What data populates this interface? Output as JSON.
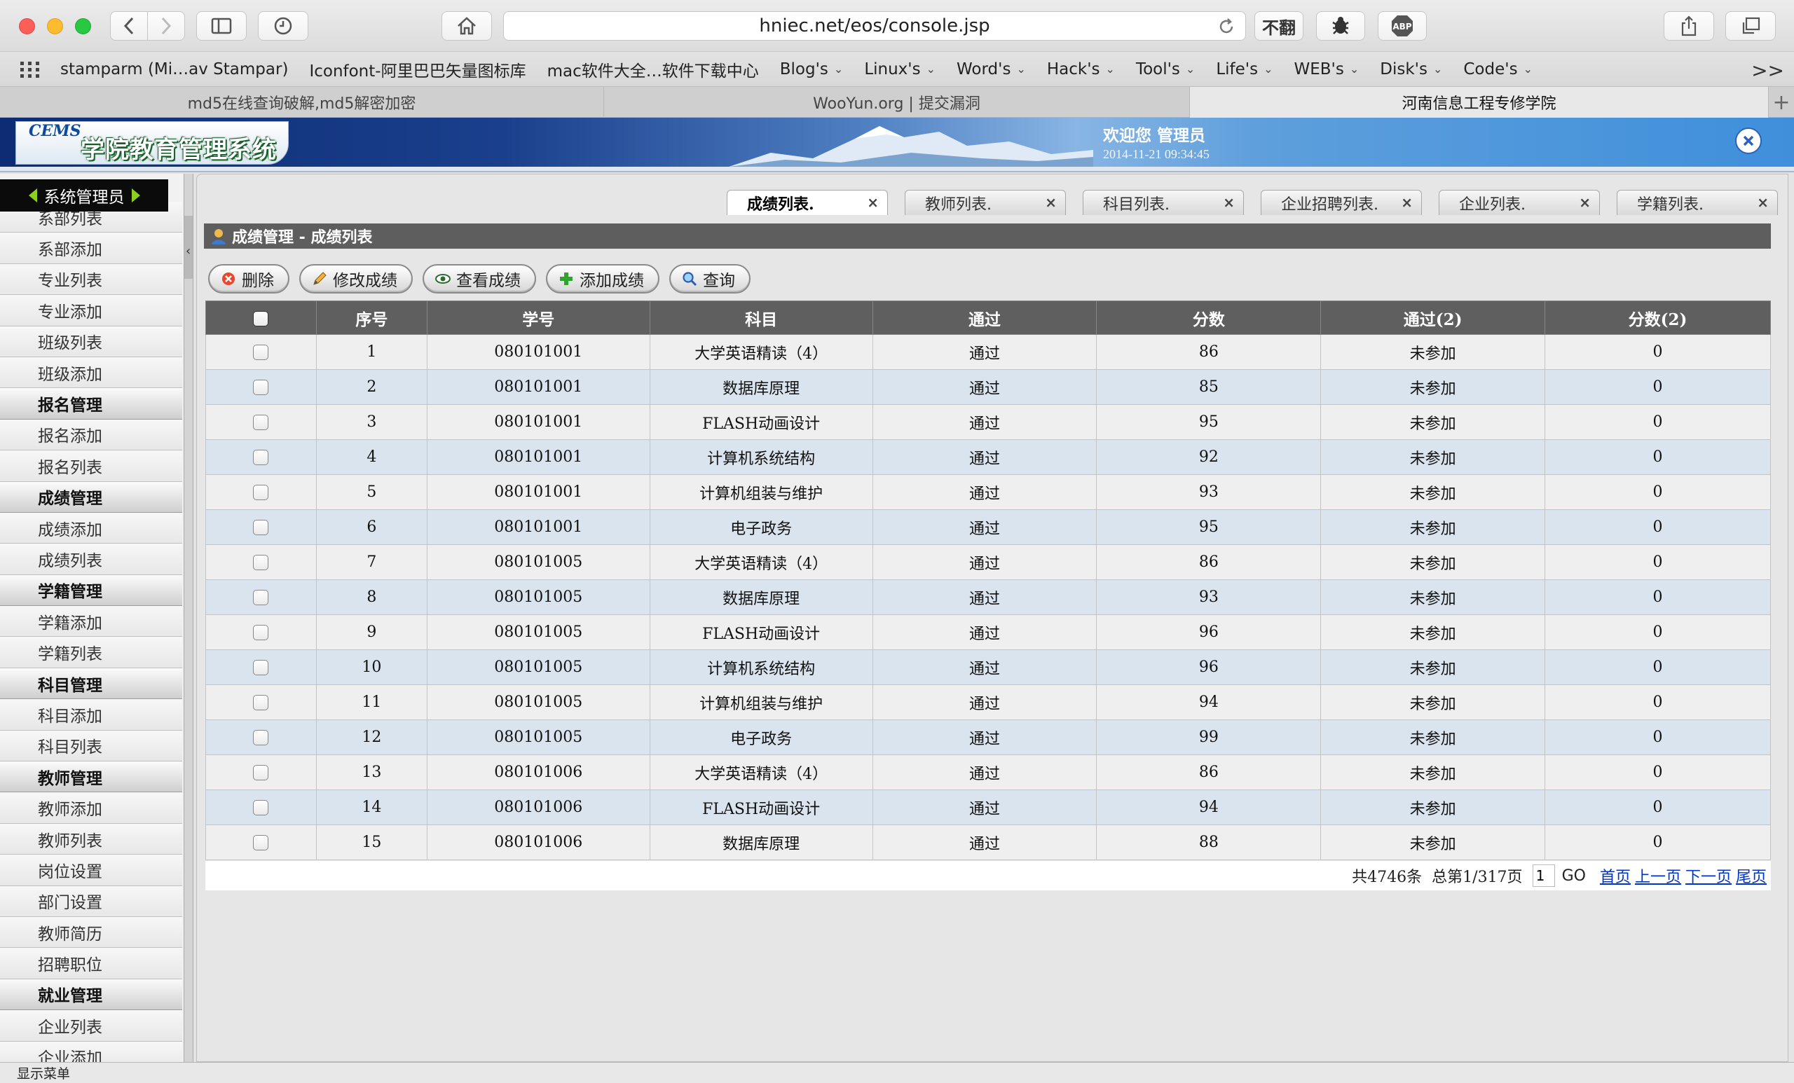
{
  "browser": {
    "url": "hniec.net/eos/console.jsp",
    "ext1": "不翻",
    "bookmarks": [
      {
        "label": "stamparm (Mi…av Stampar)",
        "menu": false
      },
      {
        "label": "Iconfont-阿里巴巴矢量图标库",
        "menu": false
      },
      {
        "label": "mac软件大全…软件下载中心",
        "menu": false
      },
      {
        "label": "Blog's",
        "menu": true
      },
      {
        "label": "Linux's",
        "menu": true
      },
      {
        "label": "Word's",
        "menu": true
      },
      {
        "label": "Hack's",
        "menu": true
      },
      {
        "label": "Tool's",
        "menu": true
      },
      {
        "label": "Life's",
        "menu": true
      },
      {
        "label": "WEB's",
        "menu": true
      },
      {
        "label": "Disk's",
        "menu": true
      },
      {
        "label": "Code's",
        "menu": true
      }
    ],
    "bookmarks_more": ">>",
    "tabs": [
      {
        "label": "md5在线查询破解,md5解密加密",
        "active": false
      },
      {
        "label": "WooYun.org | 提交漏洞",
        "active": false
      },
      {
        "label": "河南信息工程专修学院",
        "active": true
      }
    ],
    "add_tab": "+"
  },
  "header": {
    "logo_small": "CEMS",
    "logo_title": "学院教育管理系统",
    "welcome": "欢迎您 管理员",
    "datetime": "2014-11-21 09:34:45"
  },
  "sidebar": {
    "admin_label": "系统管理员",
    "items": [
      {
        "label": "系部列表",
        "type": "item"
      },
      {
        "label": "系部添加",
        "type": "item"
      },
      {
        "label": "专业列表",
        "type": "item"
      },
      {
        "label": "专业添加",
        "type": "item"
      },
      {
        "label": "班级列表",
        "type": "item"
      },
      {
        "label": "班级添加",
        "type": "item"
      },
      {
        "label": "报名管理",
        "type": "header"
      },
      {
        "label": "报名添加",
        "type": "item"
      },
      {
        "label": "报名列表",
        "type": "item"
      },
      {
        "label": "成绩管理",
        "type": "header"
      },
      {
        "label": "成绩添加",
        "type": "item"
      },
      {
        "label": "成绩列表",
        "type": "item"
      },
      {
        "label": "学籍管理",
        "type": "header"
      },
      {
        "label": "学籍添加",
        "type": "item"
      },
      {
        "label": "学籍列表",
        "type": "item"
      },
      {
        "label": "科目管理",
        "type": "header"
      },
      {
        "label": "科目添加",
        "type": "item"
      },
      {
        "label": "科目列表",
        "type": "item"
      },
      {
        "label": "教师管理",
        "type": "header"
      },
      {
        "label": "教师添加",
        "type": "item"
      },
      {
        "label": "教师列表",
        "type": "item"
      },
      {
        "label": "岗位设置",
        "type": "item"
      },
      {
        "label": "部门设置",
        "type": "item"
      },
      {
        "label": "教师简历",
        "type": "item"
      },
      {
        "label": "招聘职位",
        "type": "item"
      },
      {
        "label": "就业管理",
        "type": "header"
      },
      {
        "label": "企业列表",
        "type": "item"
      },
      {
        "label": "企业添加",
        "type": "item"
      }
    ]
  },
  "main": {
    "tabs": [
      {
        "label": "成绩列表.",
        "active": true
      },
      {
        "label": "教师列表.",
        "active": false
      },
      {
        "label": "科目列表.",
        "active": false
      },
      {
        "label": "企业招聘列表.",
        "active": false
      },
      {
        "label": "企业列表.",
        "active": false
      },
      {
        "label": "学籍列表.",
        "active": false
      }
    ],
    "tab_close": "×",
    "panel_title": "成绩管理 - 成绩列表",
    "actions": [
      {
        "label": "删除",
        "icon": "delete-icon"
      },
      {
        "label": "修改成绩",
        "icon": "edit-icon"
      },
      {
        "label": "查看成绩",
        "icon": "view-icon"
      },
      {
        "label": "添加成绩",
        "icon": "add-icon"
      },
      {
        "label": "查询",
        "icon": "search-icon"
      }
    ],
    "columns": [
      "序号",
      "学号",
      "科目",
      "通过",
      "分数",
      "通过(2)",
      "分数(2)"
    ],
    "rows": [
      [
        "1",
        "080101001",
        "大学英语精读（4）",
        "通过",
        "86",
        "未参加",
        "0"
      ],
      [
        "2",
        "080101001",
        "数据库原理",
        "通过",
        "85",
        "未参加",
        "0"
      ],
      [
        "3",
        "080101001",
        "FLASH动画设计",
        "通过",
        "95",
        "未参加",
        "0"
      ],
      [
        "4",
        "080101001",
        "计算机系统结构",
        "通过",
        "92",
        "未参加",
        "0"
      ],
      [
        "5",
        "080101001",
        "计算机组装与维护",
        "通过",
        "93",
        "未参加",
        "0"
      ],
      [
        "6",
        "080101001",
        "电子政务",
        "通过",
        "95",
        "未参加",
        "0"
      ],
      [
        "7",
        "080101005",
        "大学英语精读（4）",
        "通过",
        "86",
        "未参加",
        "0"
      ],
      [
        "8",
        "080101005",
        "数据库原理",
        "通过",
        "93",
        "未参加",
        "0"
      ],
      [
        "9",
        "080101005",
        "FLASH动画设计",
        "通过",
        "96",
        "未参加",
        "0"
      ],
      [
        "10",
        "080101005",
        "计算机系统结构",
        "通过",
        "96",
        "未参加",
        "0"
      ],
      [
        "11",
        "080101005",
        "计算机组装与维护",
        "通过",
        "94",
        "未参加",
        "0"
      ],
      [
        "12",
        "080101005",
        "电子政务",
        "通过",
        "99",
        "未参加",
        "0"
      ],
      [
        "13",
        "080101006",
        "大学英语精读（4）",
        "通过",
        "86",
        "未参加",
        "0"
      ],
      [
        "14",
        "080101006",
        "FLASH动画设计",
        "通过",
        "94",
        "未参加",
        "0"
      ],
      [
        "15",
        "080101006",
        "数据库原理",
        "通过",
        "88",
        "未参加",
        "0"
      ]
    ],
    "pager": {
      "total": "共4746条",
      "page_info": "总第1/317页",
      "page_value": "1",
      "go": "GO",
      "first": "首页",
      "prev": "上一页",
      "next": "下一页",
      "last": "尾页"
    }
  },
  "statusbar": {
    "text": "显示菜单"
  }
}
